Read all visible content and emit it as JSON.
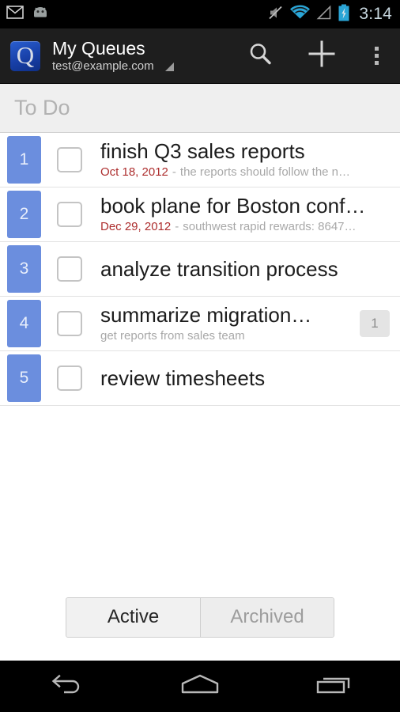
{
  "status_bar": {
    "icons": [
      "gmail-icon",
      "android-mascot-icon",
      "mute-icon",
      "wifi-icon",
      "cell-signal-icon",
      "battery-charging-icon"
    ],
    "time": "3:14"
  },
  "action_bar": {
    "logo": "queues-q-logo",
    "title": "My Queues",
    "subtitle": "test@example.com",
    "spinner_icon": "dropdown-triangle-icon",
    "actions": [
      {
        "name": "search-icon",
        "label": "Search"
      },
      {
        "name": "add-icon",
        "label": "Add"
      },
      {
        "name": "overflow-menu-icon",
        "label": "More options"
      }
    ]
  },
  "section": {
    "title": "To Do"
  },
  "tasks": [
    {
      "number": "1",
      "title": "finish Q3 sales reports",
      "date": "Oct 18, 2012",
      "separator": "-",
      "description": "the reports should follow the n…",
      "count": ""
    },
    {
      "number": "2",
      "title": "book plane for Boston conf…",
      "date": "Dec 29, 2012",
      "separator": "-",
      "description": "southwest rapid rewards: 8647…",
      "count": ""
    },
    {
      "number": "3",
      "title": "analyze transition process",
      "date": "",
      "separator": "",
      "description": "",
      "count": ""
    },
    {
      "number": "4",
      "title": "summarize migration…",
      "date": "",
      "separator": "",
      "description": "get reports from sales team",
      "count": "1"
    },
    {
      "number": "5",
      "title": "review timesheets",
      "date": "",
      "separator": "",
      "description": "",
      "count": ""
    }
  ],
  "filter_toggle": {
    "active_label": "Active",
    "archived_label": "Archived",
    "selected": "Active"
  },
  "nav_bar": {
    "back": "back-icon",
    "home": "home-icon",
    "recents": "recent-apps-icon"
  },
  "colors": {
    "accent_blue": "#6b8ede",
    "date_red": "#ad2e2e",
    "action_bar_bg": "#1e1e1e",
    "section_bg": "#efefef"
  }
}
